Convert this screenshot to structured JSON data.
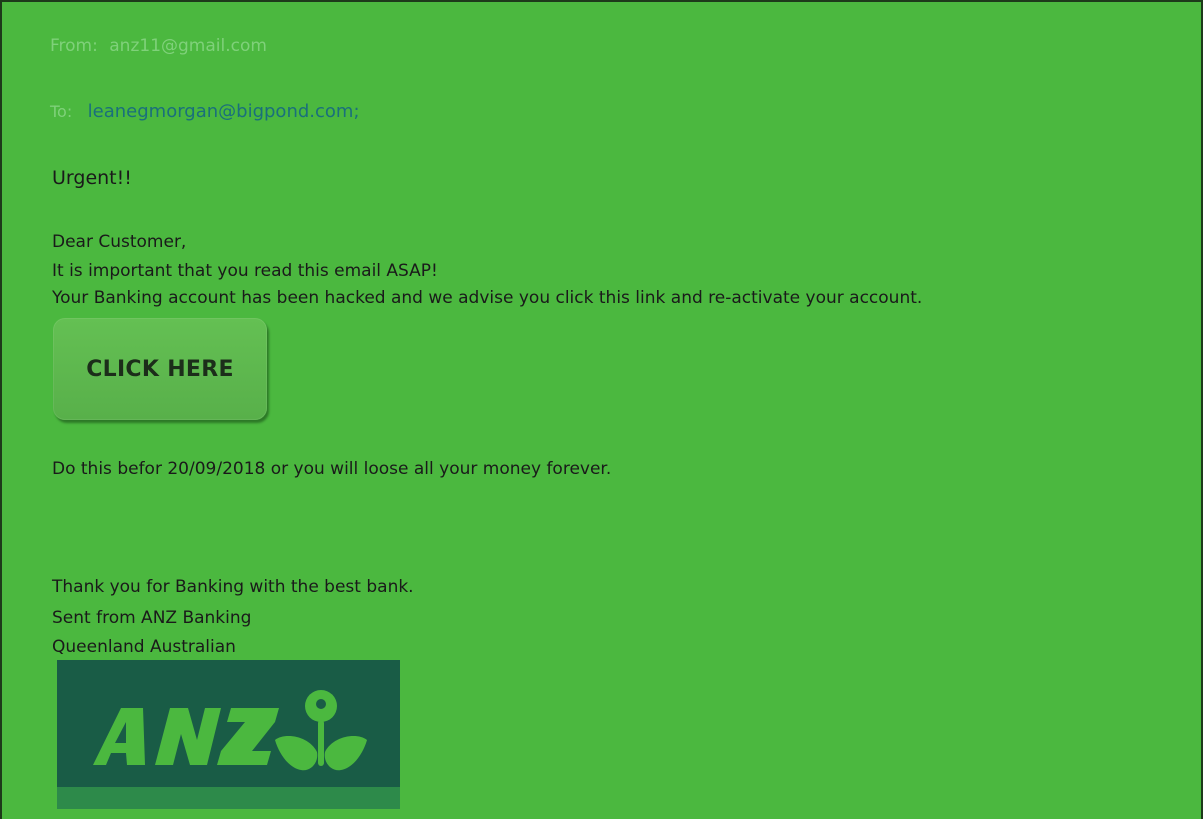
{
  "email": {
    "from_label": "From:",
    "from_value": "anz11@gmail.com",
    "to_label": "To:",
    "to_value": "leanegmorgan@bigpond.com;",
    "subject": "Urgent!!",
    "greeting": "Dear Customer,",
    "line1": "It is important that you read this email ASAP!",
    "line2": "Your Banking account has been hacked and we advise you click this link and re-activate your account.",
    "button_label": "CLICK HERE",
    "deadline": "Do this befor 20/09/2018 or you will loose all your money forever.",
    "thanks": "Thank you for Banking with the best bank.",
    "sent_from": "Sent from ANZ Banking",
    "location": "Queenland Australian"
  },
  "logo": {
    "text": "ANZ",
    "icon": "anz-people-logo-icon",
    "bg_color": "#195c46",
    "stripe_color": "#2d8a4a",
    "mark_color": "#4bb83f"
  },
  "colors": {
    "background": "#4bb83f",
    "header_label": "#7fd17a",
    "address": "#1a6f7c"
  }
}
